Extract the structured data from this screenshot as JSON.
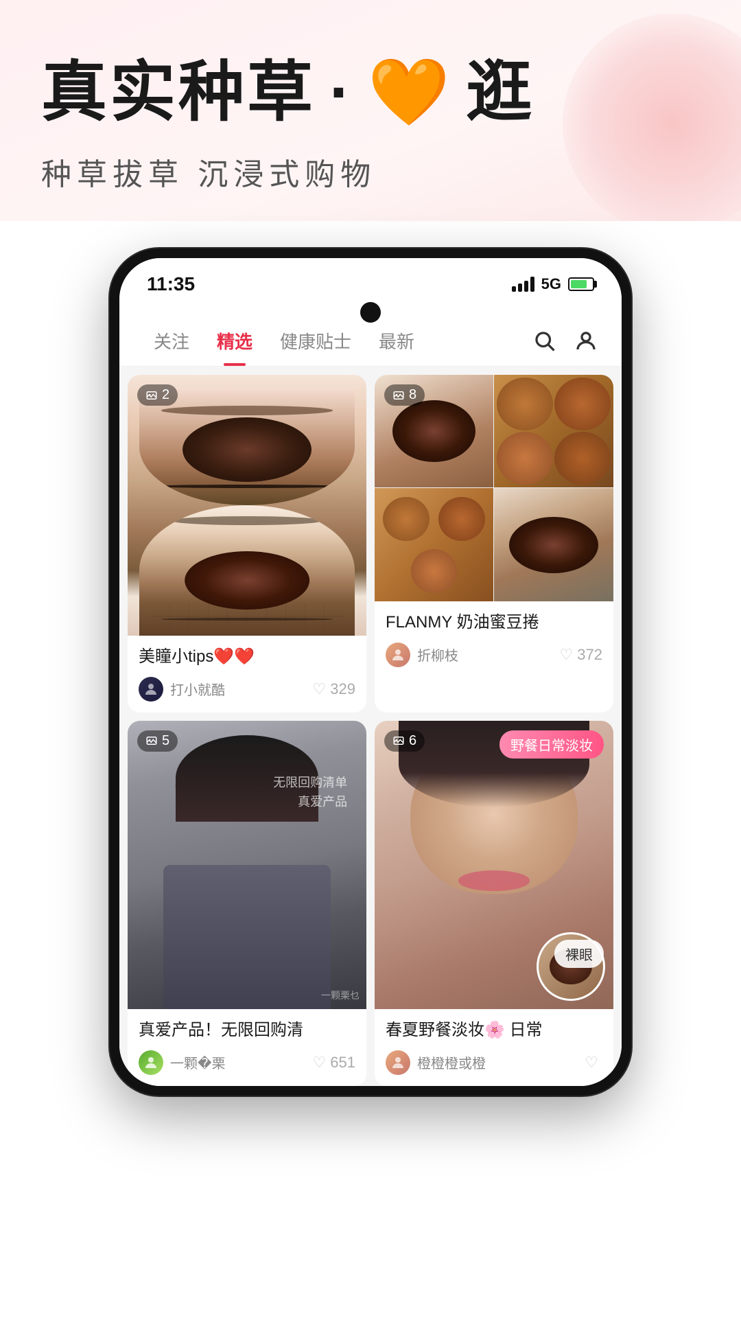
{
  "hero": {
    "title_part1": "真实种草",
    "title_separator": "·",
    "title_heart": "🧡",
    "title_part2": "逛",
    "subtitle": "种草拔草  沉浸式购物"
  },
  "phone": {
    "status": {
      "time": "11:35",
      "network": "5G"
    },
    "nav": {
      "tabs": [
        {
          "label": "关注",
          "active": false
        },
        {
          "label": "精选",
          "active": true
        },
        {
          "label": "健康贴士",
          "active": false
        },
        {
          "label": "最新",
          "active": false
        }
      ]
    },
    "feed": {
      "cards": [
        {
          "id": "card1",
          "type": "tall",
          "photoCount": 2,
          "title": "美瞳小tips❤️❤️",
          "username": "打小就酷",
          "avatarStyle": "dark",
          "likeCount": "329"
        },
        {
          "id": "card2",
          "type": "collage",
          "photoCount": 8,
          "title": "FLANMY 奶油蜜豆捲",
          "username": "折柳枝",
          "avatarStyle": "warm",
          "likeCount": "372"
        },
        {
          "id": "card3",
          "type": "tall",
          "photoCount": 5,
          "title": "真爱产品！无限回购清",
          "username": "一颗�栗",
          "avatarStyle": "green",
          "likeCount": "651",
          "subtextOverlay": "无限回购清单\n真爱产品"
        },
        {
          "id": "card4",
          "type": "tall",
          "photoCount": 6,
          "title": "春夏野餐淡妆🌸 日常",
          "tag": "野餐日常淡妆",
          "nakeBadge": "裸眼",
          "username": "橙橙橙或橙",
          "avatarStyle": "warm",
          "likeCount": ""
        }
      ]
    }
  }
}
